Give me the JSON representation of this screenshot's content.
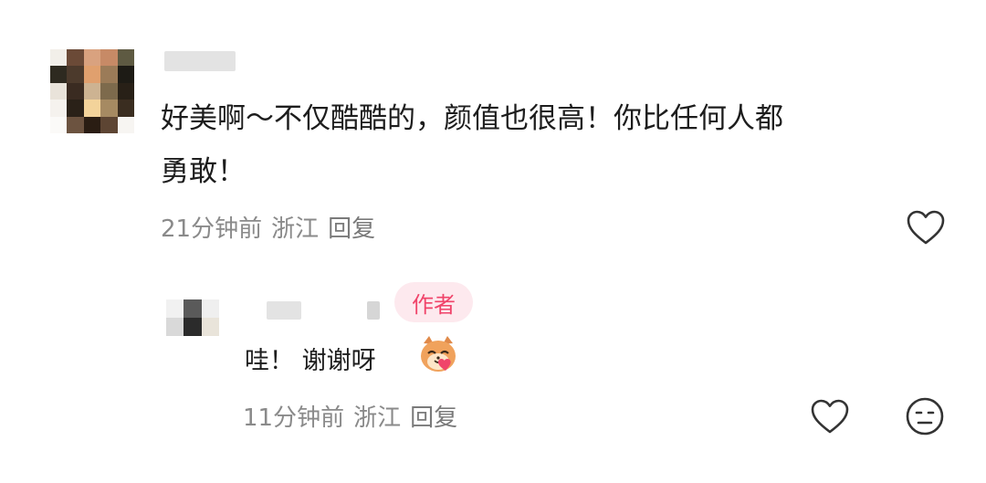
{
  "comment": {
    "text_line1": "好美啊～不仅酷酷的，颜值也很高！你比任何人都",
    "text_line2": "勇敢！",
    "time": "21分钟前",
    "location": "浙江",
    "reply_label": "回复",
    "avatar_icon": "pixelated-avatar",
    "avatar_colors": [
      "#f2efe9",
      "#6b4a37",
      "#d9a27f",
      "#c78a66",
      "#5e5a42",
      "#2e2a20",
      "#4c3a2c",
      "#e0a06e",
      "#9b7b58",
      "#1d1b15",
      "#e9e3da",
      "#3a2b21",
      "#cdb392",
      "#7d6a4c",
      "#282017",
      "#f5f2ee",
      "#2a2118",
      "#f3d39a",
      "#a68a62",
      "#3a2d20",
      "#fbfaf8",
      "#6c5340",
      "#2a1d13",
      "#5d4533",
      "#f7f5f2"
    ]
  },
  "reply": {
    "badge": "作者",
    "text": "哇！ 谢谢呀",
    "sticker_icon": "cat-heart-sticker",
    "time": "11分钟前",
    "location": "浙江",
    "reply_label": "回复",
    "avatar_icon": "pixelated-avatar",
    "avatar_colors": [
      "#f1f1f1",
      "#5a5a5a",
      "#efefef",
      "#d9d9d9",
      "#2b2b2b",
      "#e9e4da"
    ]
  },
  "colors": {
    "badge_bg": "#fde9ee",
    "badge_text": "#f0446a",
    "meta_text": "#8a8a8a"
  }
}
